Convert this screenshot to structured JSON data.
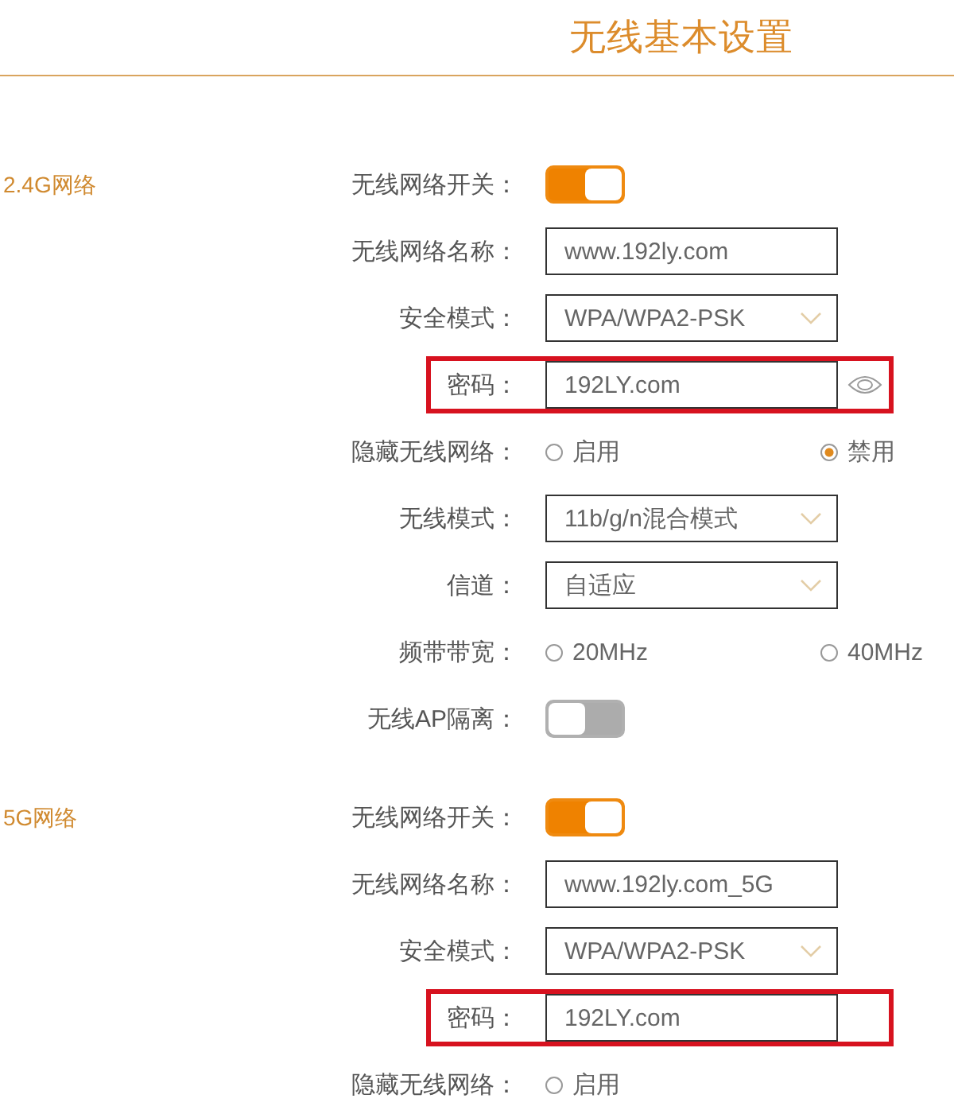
{
  "header": {
    "title": "无线基本设置"
  },
  "sections": [
    {
      "label": "2.4G网络",
      "rows": [
        {
          "kind": "switch",
          "label": "无线网络开关：",
          "on": true,
          "highlighted": false
        },
        {
          "kind": "text",
          "label": "无线网络名称：",
          "value": "www.192ly.com",
          "highlighted": false
        },
        {
          "kind": "select",
          "label": "安全模式：",
          "value": "WPA/WPA2-PSK",
          "highlighted": false
        },
        {
          "kind": "password",
          "label": "密码：",
          "value": "192LY.com",
          "show_toggle": true,
          "highlighted": true
        },
        {
          "kind": "radio",
          "label": "隐藏无线网络：",
          "options": [
            {
              "label": "启用",
              "selected": false
            },
            {
              "label": "禁用",
              "selected": true
            }
          ],
          "highlighted": false
        },
        {
          "kind": "select",
          "label": "无线模式：",
          "value": "11b/g/n混合模式",
          "highlighted": false
        },
        {
          "kind": "select",
          "label": "信道：",
          "value": "自适应",
          "highlighted": false
        },
        {
          "kind": "radio",
          "label": "频带带宽：",
          "options": [
            {
              "label": "20MHz",
              "selected": false
            },
            {
              "label": "40MHz",
              "selected": false
            }
          ],
          "highlighted": false
        },
        {
          "kind": "switch",
          "label": "无线AP隔离：",
          "on": false,
          "highlighted": false
        }
      ]
    },
    {
      "label": "5G网络",
      "rows": [
        {
          "kind": "switch",
          "label": "无线网络开关：",
          "on": true,
          "highlighted": false
        },
        {
          "kind": "text",
          "label": "无线网络名称：",
          "value": "www.192ly.com_5G",
          "highlighted": false
        },
        {
          "kind": "select",
          "label": "安全模式：",
          "value": "WPA/WPA2-PSK",
          "highlighted": false
        },
        {
          "kind": "password",
          "label": "密码：",
          "value": "192LY.com",
          "show_toggle": false,
          "highlighted": true
        },
        {
          "kind": "radio",
          "label": "隐藏无线网络：",
          "options": [
            {
              "label": "启用",
              "selected": false
            }
          ],
          "highlighted": false
        }
      ]
    }
  ]
}
